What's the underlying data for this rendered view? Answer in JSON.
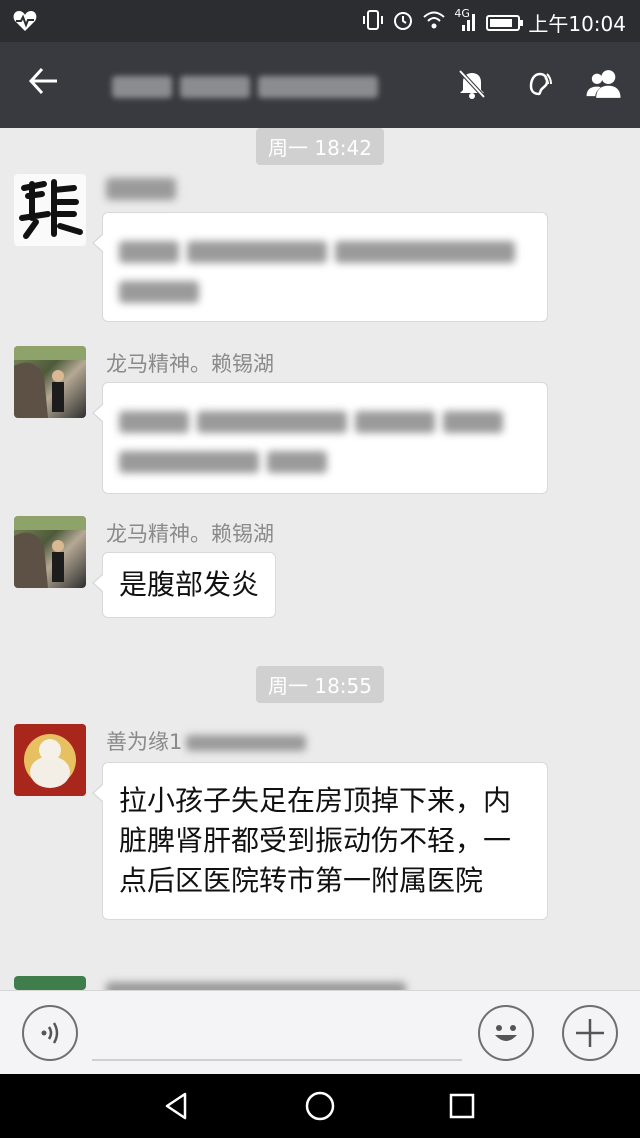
{
  "status_bar": {
    "time": "上午10:04",
    "network": "4G",
    "battery_level": 0.85,
    "icons": [
      "heart-pulse-icon",
      "vibrate-icon",
      "alarm-icon",
      "wifi-icon",
      "signal-icon",
      "battery-icon"
    ]
  },
  "title_bar": {
    "back_icon": "back-arrow-icon",
    "icons": [
      "mute-icon",
      "earpiece-icon",
      "group-members-icon"
    ]
  },
  "messages": [
    {
      "type": "timestamp",
      "text": "周一 18:42"
    },
    {
      "type": "text",
      "sender": "",
      "text": "",
      "blurred": true
    },
    {
      "type": "text",
      "sender": "龙马精神。赖锡湖",
      "text": "",
      "blurred": true
    },
    {
      "type": "text",
      "sender": "龙马精神。赖锡湖",
      "text": "是腹部发炎"
    },
    {
      "type": "timestamp",
      "text": "周一 18:55"
    },
    {
      "type": "text",
      "sender": "善为缘1",
      "text": "拉小孩子失足在房顶掉下来，内脏脾肾肝都受到振动伤不轻，一点后区医院转市第一附属医院"
    }
  ],
  "input_bar": {
    "voice_icon": "voice-icon",
    "emoji_icon": "emoji-icon",
    "more_icon": "plus-icon"
  },
  "nav_bar": {
    "icons": [
      "back-triangle-icon",
      "home-circle-icon",
      "recents-square-icon"
    ]
  }
}
